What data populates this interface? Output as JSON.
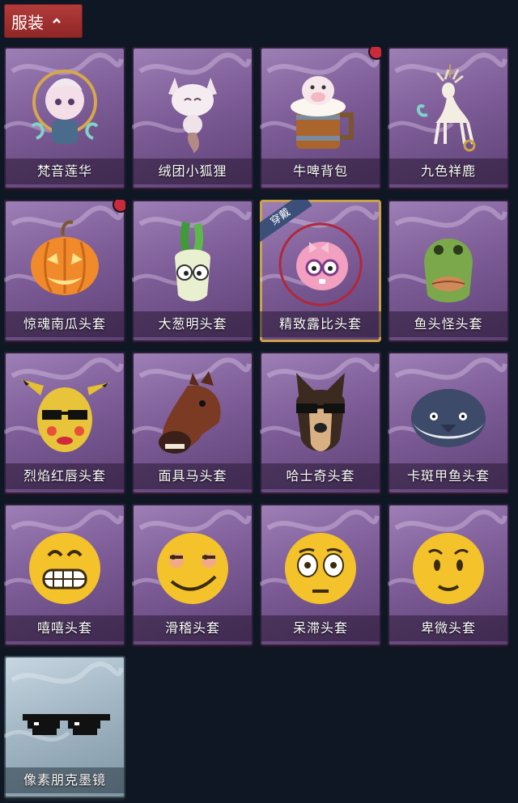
{
  "header": {
    "label": "服装"
  },
  "items": [
    {
      "label": "梵音莲华",
      "icon": "ornate-character-icon",
      "dot": false
    },
    {
      "label": "绒团小狐狸",
      "icon": "fox-plush-icon",
      "dot": false
    },
    {
      "label": "牛啤背包",
      "icon": "beer-mug-backpack-icon",
      "dot": true
    },
    {
      "label": "九色祥鹿",
      "icon": "deer-icon",
      "dot": false
    },
    {
      "label": "惊魂南瓜头套",
      "icon": "pumpkin-mask-icon",
      "dot": true
    },
    {
      "label": "大葱明头套",
      "icon": "scallion-mask-icon",
      "dot": false
    },
    {
      "label": "精致露比头套",
      "icon": "ruby-mask-icon",
      "dot": false,
      "equipped": true,
      "badge": "穿戴"
    },
    {
      "label": "鱼头怪头套",
      "icon": "fish-head-mask-icon",
      "dot": false
    },
    {
      "label": "烈焰红唇头套",
      "icon": "yellow-mask-sunglasses-icon",
      "dot": false
    },
    {
      "label": "面具马头套",
      "icon": "horse-mask-icon",
      "dot": false
    },
    {
      "label": "哈士奇头套",
      "icon": "husky-mask-icon",
      "dot": false
    },
    {
      "label": "卡斑甲鱼头套",
      "icon": "fish-mask-icon",
      "dot": false
    },
    {
      "label": "嘻嘻头套",
      "icon": "grin-emoji-icon",
      "dot": false
    },
    {
      "label": "滑稽头套",
      "icon": "smirk-emoji-icon",
      "dot": false
    },
    {
      "label": "呆滞头套",
      "icon": "stunned-emoji-icon",
      "dot": false
    },
    {
      "label": "卑微头套",
      "icon": "humble-emoji-icon",
      "dot": false
    },
    {
      "label": "像素朋克墨镜",
      "icon": "pixel-sunglasses-icon",
      "dot": false,
      "rarity": "blue"
    }
  ]
}
